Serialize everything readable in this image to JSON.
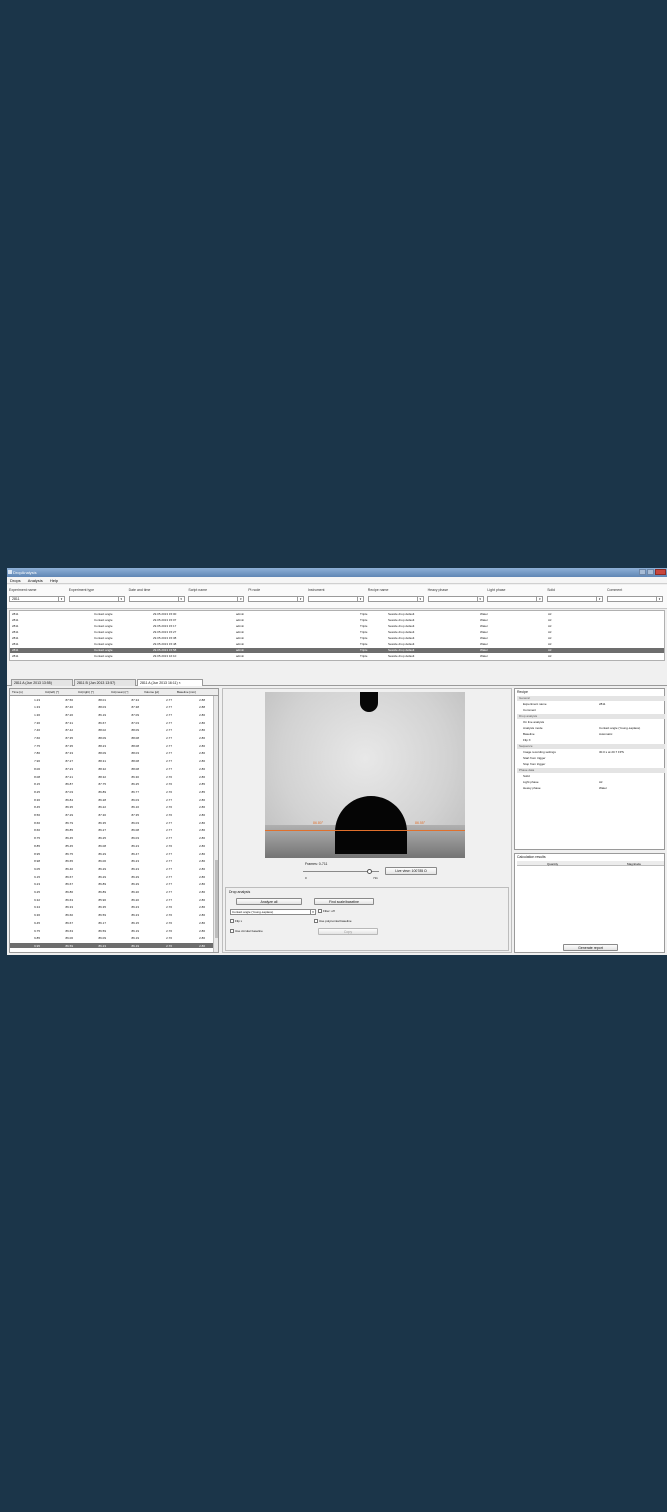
{
  "window": {
    "title": "DropAnalysis"
  },
  "menu": [
    "Drops",
    "Analysis",
    "Help"
  ],
  "filters": [
    {
      "label": "Experiment name",
      "value": "2811"
    },
    {
      "label": "Experiment type",
      "value": ""
    },
    {
      "label": "Date and time",
      "value": ""
    },
    {
      "label": "Script name",
      "value": ""
    },
    {
      "label": "Pt node",
      "value": ""
    },
    {
      "label": "Instrument",
      "value": ""
    },
    {
      "label": "Recipe name",
      "value": ""
    },
    {
      "label": "Heavy phase",
      "value": ""
    },
    {
      "label": "Light phase",
      "value": ""
    },
    {
      "label": "Solid",
      "value": ""
    },
    {
      "label": "Comment",
      "value": ""
    }
  ],
  "experiments": [
    {
      "name": "2811",
      "type": "Contact angle",
      "date": "29.05.2013 15:00",
      "user": "admin",
      "status": "Triple",
      "recipe": "Sessile drop default",
      "heavy": "Water",
      "light": "Air",
      "selected": false
    },
    {
      "name": "2811",
      "type": "Contact angle",
      "date": "29.05.2013 15:07",
      "user": "admin",
      "status": "Triple",
      "recipe": "Sessile drop default",
      "heavy": "Water",
      "light": "Air",
      "selected": false
    },
    {
      "name": "2811",
      "type": "Contact angle",
      "date": "29.05.2013 15:17",
      "user": "admin",
      "status": "Triple",
      "recipe": "Sessile drop default",
      "heavy": "Water",
      "light": "Air",
      "selected": false
    },
    {
      "name": "2811",
      "type": "Contact angle",
      "date": "29.05.2013 15:27",
      "user": "admin",
      "status": "Triple",
      "recipe": "Sessile drop default",
      "heavy": "Water",
      "light": "Air",
      "selected": false
    },
    {
      "name": "2811",
      "type": "Contact angle",
      "date": "29.05.2013 15:38",
      "user": "admin",
      "status": "Triple",
      "recipe": "Sessile drop default",
      "heavy": "Water",
      "light": "Air",
      "selected": false
    },
    {
      "name": "2811",
      "type": "Contact angle",
      "date": "29.05.2013 15:48",
      "user": "admin",
      "status": "Triple",
      "recipe": "Sessile drop default",
      "heavy": "Water",
      "light": "Air",
      "selected": false
    },
    {
      "name": "2811",
      "type": "Contact angle",
      "date": "29.05.2013 15:58",
      "user": "admin",
      "status": "Triple",
      "recipe": "Sessile drop default",
      "heavy": "Water",
      "light": "Air",
      "selected": true
    },
    {
      "name": "2811",
      "type": "Contact angle",
      "date": "29.05.2013 16:10",
      "user": "admin",
      "status": "Triple",
      "recipe": "Sessile drop default",
      "heavy": "Water",
      "light": "Air",
      "selected": false
    }
  ],
  "tabs": [
    {
      "label": "2811 A (Jun 2013 13:55)",
      "active": false
    },
    {
      "label": "2811 B (Jun 2013 13:57)",
      "active": false
    },
    {
      "label": "2811 A (Jun 2013 16:11)",
      "active": true,
      "close": "×"
    }
  ],
  "data_table": {
    "headers": [
      "Time [s]",
      "CA(left) [°]",
      "CA(right) [°]",
      "CA(mean) [°]",
      "Volume [µl]",
      "Baseline [mm]"
    ],
    "rows": [
      [
        "1.23",
        "87.56",
        "88.01",
        "87.34",
        "2.77",
        "2.88"
      ],
      [
        "1.33",
        "87.46",
        "88.03",
        "87.38",
        "2.77",
        "2.88"
      ],
      [
        "1.36",
        "87.26",
        "86.19",
        "87.09",
        "2.77",
        "2.86"
      ],
      [
        "7.36",
        "87.31",
        "86.67",
        "87.03",
        "2.77",
        "2.86"
      ],
      [
        "7.46",
        "87.42",
        "88.02",
        "88.09",
        "2.77",
        "2.86"
      ],
      [
        "7.66",
        "87.35",
        "88.09",
        "88.08",
        "2.77",
        "2.86"
      ],
      [
        "7.75",
        "87.35",
        "88.23",
        "88.08",
        "2.77",
        "2.86"
      ],
      [
        "7.86",
        "87.33",
        "88.09",
        "88.03",
        "2.77",
        "2.86"
      ],
      [
        "7.96",
        "87.27",
        "88.31",
        "88.08",
        "2.77",
        "2.86"
      ],
      [
        "8.06",
        "87.23",
        "88.32",
        "88.08",
        "2.77",
        "2.86"
      ],
      [
        "8.08",
        "87.21",
        "88.32",
        "86.30",
        "2.76",
        "2.86"
      ],
      [
        "8.15",
        "86.87",
        "87.75",
        "86.25",
        "2.76",
        "2.85"
      ],
      [
        "8.25",
        "87.03",
        "86.89",
        "86.77",
        "2.76",
        "2.85"
      ],
      [
        "8.36",
        "86.84",
        "86.28",
        "86.03",
        "2.77",
        "2.86"
      ],
      [
        "8.45",
        "86.35",
        "86.22",
        "86.16",
        "2.76",
        "2.86"
      ],
      [
        "8.56",
        "87.29",
        "87.30",
        "87.35",
        "2.76",
        "2.86"
      ],
      [
        "8.66",
        "86.79",
        "86.35",
        "86.03",
        "2.77",
        "2.86"
      ],
      [
        "8.66",
        "86.85",
        "86.27",
        "86.08",
        "2.77",
        "2.86"
      ],
      [
        "8.75",
        "86.45",
        "86.25",
        "86.03",
        "2.77",
        "2.86"
      ],
      [
        "8.85",
        "85.45",
        "86.08",
        "86.23",
        "2.76",
        "2.86"
      ],
      [
        "8.95",
        "86.75",
        "86.29",
        "86.47",
        "2.77",
        "2.86"
      ],
      [
        "8.98",
        "86.65",
        "86.06",
        "86.23",
        "2.77",
        "2.86"
      ],
      [
        "9.05",
        "86.40",
        "86.29",
        "86.23",
        "2.77",
        "2.86"
      ],
      [
        "9.15",
        "86.67",
        "86.29",
        "86.29",
        "2.77",
        "2.86"
      ],
      [
        "9.23",
        "86.67",
        "86.89",
        "86.29",
        "2.77",
        "2.86"
      ],
      [
        "9.25",
        "86.86",
        "86.89",
        "86.20",
        "2.77",
        "2.86"
      ],
      [
        "9.32",
        "86.63",
        "85.96",
        "86.20",
        "2.77",
        "2.86"
      ],
      [
        "9.34",
        "86.33",
        "86.35",
        "86.23",
        "2.76",
        "2.86"
      ],
      [
        "9.36",
        "86.60",
        "86.59",
        "86.23",
        "2.76",
        "2.86"
      ],
      [
        "9.45",
        "86.67",
        "86.17",
        "86.15",
        "2.76",
        "2.86"
      ],
      [
        "9.75",
        "86.63",
        "86.59",
        "86.19",
        "2.76",
        "2.86"
      ],
      [
        "9.85",
        "86.06",
        "86.09",
        "86.19",
        "2.76",
        "2.86"
      ],
      [
        "9.95",
        "86.59",
        "86.23",
        "86.19",
        "2.76",
        "2.86"
      ]
    ]
  },
  "viewer": {
    "angle_left": "86.80°",
    "angle_right": "86.55°",
    "frame_label": "Frames: 0-711",
    "frame_min": "0",
    "frame_max": "711",
    "frame_position": 0.9,
    "live_button": "Live view: 100785 Ω"
  },
  "drop_analysis": {
    "title": "Drop analysis",
    "analyze_all": "Analyze all",
    "find_scale": "Find scale/baseline",
    "method": "Contact angle (Young-Laplace)",
    "filter_label": "Filter: off",
    "flip": "Flip x",
    "use_polynomial": "Use polynomial baseline",
    "use_circle": "Use circular baseline",
    "copy": "Copy"
  },
  "recipe": {
    "title": "Recipe",
    "rows": [
      {
        "kind": "section",
        "k": "General",
        "v": ""
      },
      {
        "kind": "row",
        "k": "Experiment name",
        "v": "2811"
      },
      {
        "kind": "row",
        "k": "Comment",
        "v": ""
      },
      {
        "kind": "section",
        "k": "Drop analysis",
        "v": ""
      },
      {
        "kind": "row",
        "k": "On line analysis",
        "v": ""
      },
      {
        "kind": "row",
        "k": "Analysis mode",
        "v": "Contact angle (Young-Laplace)"
      },
      {
        "kind": "row",
        "k": "Baseline",
        "v": "Automatic"
      },
      {
        "kind": "row",
        "k": "Flip X",
        "v": ""
      },
      {
        "kind": "section",
        "k": "Sequence",
        "v": ""
      },
      {
        "kind": "row",
        "k": "Image recording settings",
        "v": "30.0 s at 20.7 FPS"
      },
      {
        "kind": "row",
        "k": "Start from trigger",
        "v": ""
      },
      {
        "kind": "row",
        "k": "Stop from trigger",
        "v": ""
      },
      {
        "kind": "section",
        "k": "Phase data",
        "v": ""
      },
      {
        "kind": "row",
        "k": "Solid",
        "v": ""
      },
      {
        "kind": "row",
        "k": "Light phase",
        "v": "Air"
      },
      {
        "kind": "row",
        "k": "Heavy phase",
        "v": "Water"
      }
    ]
  },
  "calc_results": {
    "title": "Calculation results",
    "col_quantity": "Quantity",
    "col_magnitude": "Magnitude",
    "export": "Generate report"
  }
}
